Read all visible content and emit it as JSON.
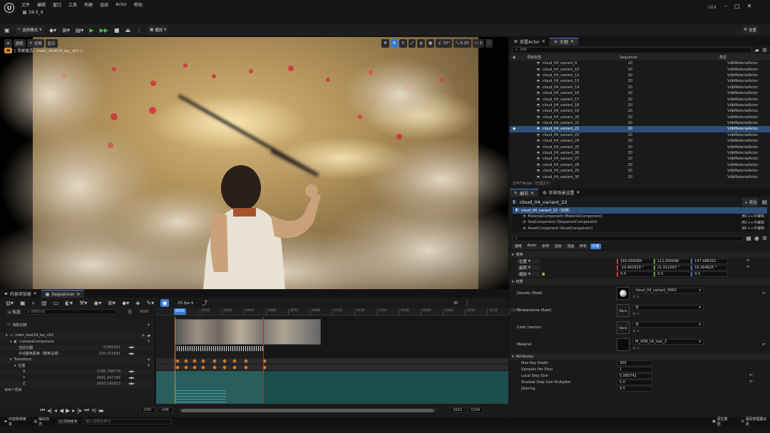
{
  "titlebar": {
    "menus": [
      "文件",
      "编辑",
      "窗口",
      "工具",
      "构建",
      "选择",
      "Actor",
      "帮助"
    ],
    "tab": "19-3_4",
    "engine": "UE4"
  },
  "toolbar": {
    "mode": "选择模式",
    "play": "播放",
    "settings": "设置"
  },
  "viewport": {
    "view_btn": "透视",
    "lit_btn": "光照",
    "show_btn": "显示",
    "pilot_label": "[ 驾驶激活 - main_shot19_lay_v01 ]",
    "snap_angle": "10°",
    "snap_scale": "0.25",
    "cam_speed": "1"
  },
  "outliner": {
    "tabs": [
      "放置Actor",
      "大纲"
    ],
    "search_placeholder": "搜索",
    "col_label": "项目标签",
    "col_seq": "Sequence",
    "col_type": "类型",
    "rows": [
      {
        "name": "cloud_04_variant_9",
        "seq": "20",
        "type": "VdbMaterialActor"
      },
      {
        "name": "cloud_04_variant_10",
        "seq": "20",
        "type": "VdbMaterialActor"
      },
      {
        "name": "cloud_04_variant_12",
        "seq": "20",
        "type": "VdbMaterialActor"
      },
      {
        "name": "cloud_04_variant_13",
        "seq": "20",
        "type": "VdbMaterialActor"
      },
      {
        "name": "cloud_04_variant_14",
        "seq": "20",
        "type": "VdbMaterialActor"
      },
      {
        "name": "cloud_04_variant_16",
        "seq": "20",
        "type": "VdbMaterialActor"
      },
      {
        "name": "cloud_04_variant_17",
        "seq": "20",
        "type": "VdbMaterialActor"
      },
      {
        "name": "cloud_04_variant_18",
        "seq": "20",
        "type": "VdbMaterialActor"
      },
      {
        "name": "cloud_04_variant_19",
        "seq": "20",
        "type": "VdbMaterialActor"
      },
      {
        "name": "cloud_04_variant_20",
        "seq": "20",
        "type": "VdbMaterialActor"
      },
      {
        "name": "cloud_04_variant_21",
        "seq": "20",
        "type": "VdbMaterialActor"
      },
      {
        "name": "cloud_04_variant_22",
        "seq": "20",
        "type": "VdbMaterialActor"
      },
      {
        "name": "cloud_04_variant_23",
        "seq": "20",
        "type": "VdbMaterialActor"
      },
      {
        "name": "cloud_04_variant_24",
        "seq": "20",
        "type": "VdbMaterialActor"
      },
      {
        "name": "cloud_04_variant_25",
        "seq": "20",
        "type": "VdbMaterialActor"
      },
      {
        "name": "cloud_04_variant_26",
        "seq": "20",
        "type": "VdbMaterialActor"
      },
      {
        "name": "cloud_04_variant_27",
        "seq": "20",
        "type": "VdbMaterialActor"
      },
      {
        "name": "cloud_04_variant_28",
        "seq": "20",
        "type": "VdbMaterialActor"
      },
      {
        "name": "cloud_04_variant_29",
        "seq": "20",
        "type": "VdbMaterialActor"
      },
      {
        "name": "cloud_04_variant_30",
        "seq": "20",
        "type": "VdbMaterialActor"
      },
      {
        "name": "cloud_04_variant_31",
        "seq": "20",
        "type": "VdbMaterialActor"
      }
    ],
    "footer": "274个Actor（已选1个）"
  },
  "details": {
    "tabs": [
      "细节",
      "世界场景设置"
    ],
    "actor_name": "cloud_04_variant_22",
    "add_btn": "+ 添加",
    "components": [
      {
        "name": "cloud_04_variant_22（实例）",
        "link": ""
      },
      {
        "name": "MaterialComponent (MaterialComponent)",
        "link": "用C++中编辑"
      },
      {
        "name": "SeqComponent (SequenceComponent)",
        "link": "用C++中编辑"
      },
      {
        "name": "AssetComponent (AssetComponent)",
        "link": "用C++中编辑"
      }
    ],
    "filters": [
      "通用",
      "Actor",
      "杂项",
      "渲染",
      "流送",
      "所有",
      "外观"
    ],
    "transform_header": "变换",
    "location_label": "位置",
    "location": [
      "160.000084",
      "111.000046",
      "147.086252"
    ],
    "rotation_label": "旋转",
    "rotation": [
      "-10.491829 °",
      "21.012093 °",
      "18.264626 °"
    ],
    "scale_label": "缩放",
    "scale": [
      "0.5",
      "0.5",
      "0.5"
    ],
    "material_header": "材质",
    "density_label": "Density (float)",
    "density_asset": "cloud_04_variant_0060",
    "temperature_label": "Temperature (float)",
    "color_label": "Color (vector)",
    "none_text": "None",
    "none_dropdown": "无",
    "material_label": "Material",
    "material_asset": "M_VDB_LR_test_2",
    "attributes_header": "Attributes",
    "max_ray_label": "Max Ray Depth",
    "max_ray": "300",
    "spp_label": "Samples Per Pixel",
    "spp": "1",
    "local_step_label": "Local Step Size",
    "local_step": "5.000741",
    "shadow_step_label": "Shadow Step Size Multiplier",
    "shadow_step": "5.0",
    "jittering_label": "Jittering",
    "jittering": "0.5"
  },
  "sequencer": {
    "tabs": [
      "内容浏览器",
      "Sequencer"
    ],
    "fps": "25 fps",
    "track_btn": "+ 轨道",
    "search_placeholder": "搜索轨道",
    "current_frame": "0000",
    "playhead": "0000",
    "ruler": [
      "0015",
      "0030",
      "0045",
      "0060",
      "0075",
      "0090",
      "0105",
      "0120",
      "0135",
      "0150",
      "0165",
      "0180",
      "0195",
      "0210",
      "0225"
    ],
    "right_count": "30",
    "camera_cuts": "相机切换",
    "shot_name": "main_shot19_lay_v01",
    "camera_component": "CameraComponent",
    "focal_label": "当前光圈",
    "focal_value": "0.583147",
    "focus_label": "手动聚焦距离（聚焦设置）",
    "focus_value": "329.315891",
    "transform_label": "Transform",
    "location_label": "位置",
    "x_label": "X",
    "x_value": "1745.748779",
    "y_label": "Y",
    "y_value": "4681.347168",
    "z_label": "Z",
    "z_value": "2693.142822",
    "items_count": "306个项目",
    "range_start": "-030",
    "range_in": "-008",
    "range_out": "0262",
    "range_end": "0294"
  },
  "statusbar": {
    "drawer": "内容侧滑菜单",
    "log": "输出日志",
    "cmd": "Cmd",
    "console_placeholder": "输入控制台命令",
    "save": "源生数据",
    "source": "源码管理器关闭"
  },
  "colors": {
    "accent": "#3a7bd5",
    "key_orange": "#d77c2b",
    "track_teal": "#2a6a6a",
    "selection": "#2d4f7a"
  }
}
